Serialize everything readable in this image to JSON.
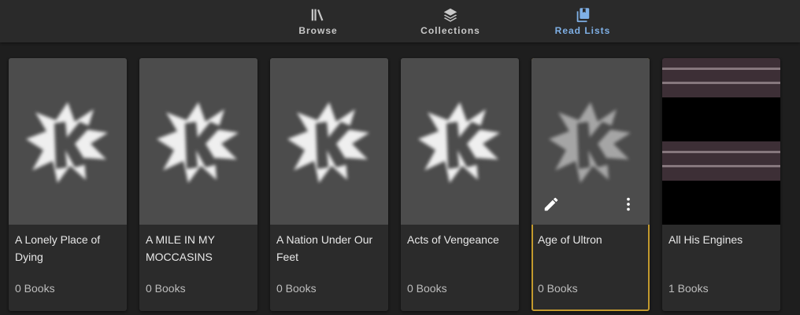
{
  "nav": {
    "tabs": [
      {
        "label": "Browse"
      },
      {
        "label": "Collections"
      },
      {
        "label": "Read Lists"
      }
    ]
  },
  "readlists": [
    {
      "title": "A Lonely Place of Dying",
      "count": "0 Books"
    },
    {
      "title": "A MILE IN MY MOCCASINS",
      "count": "0 Books"
    },
    {
      "title": "A Nation Under Our Feet",
      "count": "0 Books"
    },
    {
      "title": "Acts of Vengeance",
      "count": "0 Books"
    },
    {
      "title": "Age of Ultron",
      "count": "0 Books"
    },
    {
      "title": "All His Engines",
      "count": "1 Books"
    }
  ],
  "colors": {
    "accent_active_tab": "#7fb0e6",
    "hover_outline": "#c39a2e",
    "background": "#1e1e1e",
    "card": "#2b2b2b"
  }
}
